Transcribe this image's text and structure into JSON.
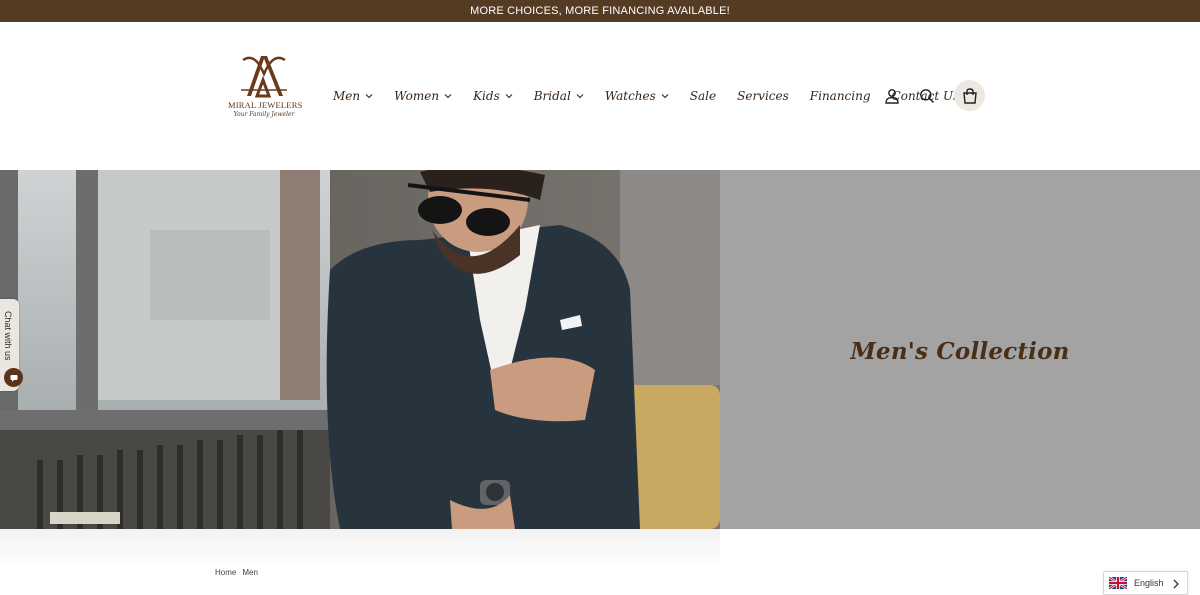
{
  "announcement": "MORE CHOICES, MORE FINANCING AVAILABLE!",
  "logo": {
    "name": "MIRAL JEWELERS",
    "tagline": "Your Family Jeweler"
  },
  "nav": [
    {
      "label": "Men",
      "dropdown": true
    },
    {
      "label": "Women",
      "dropdown": true
    },
    {
      "label": "Kids",
      "dropdown": true
    },
    {
      "label": "Bridal",
      "dropdown": true
    },
    {
      "label": "Watches",
      "dropdown": true
    },
    {
      "label": "Sale",
      "dropdown": false
    },
    {
      "label": "Services",
      "dropdown": false
    },
    {
      "label": "Financing",
      "dropdown": false
    },
    {
      "label": "Contact Us",
      "dropdown": false
    }
  ],
  "header_icons": [
    "account-icon",
    "search-icon",
    "shopping-bag-icon"
  ],
  "hero": {
    "title": "Men's Collection"
  },
  "breadcrumb": [
    "Home",
    "Men"
  ],
  "chat": {
    "label": "Chat with us"
  },
  "language": {
    "label": "English"
  },
  "colors": {
    "brand_brown": "#543b24",
    "hero_panel": "#a3a3a3",
    "title_brown": "#4a2f17"
  }
}
